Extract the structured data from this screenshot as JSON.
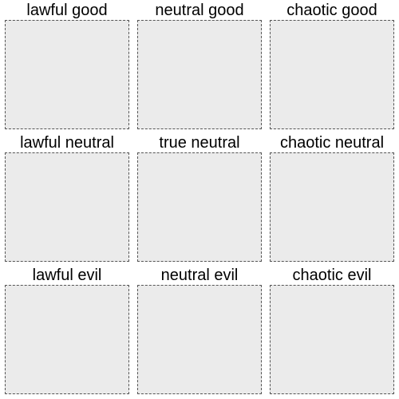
{
  "grid": {
    "cells": [
      {
        "id": "lawful-good",
        "label": "lawful good"
      },
      {
        "id": "neutral-good",
        "label": "neutral good"
      },
      {
        "id": "chaotic-good",
        "label": "chaotic good"
      },
      {
        "id": "lawful-neutral",
        "label": "lawful neutral"
      },
      {
        "id": "true-neutral",
        "label": "true neutral"
      },
      {
        "id": "chaotic-neutral",
        "label": "chaotic neutral"
      },
      {
        "id": "lawful-evil",
        "label": "lawful evil"
      },
      {
        "id": "neutral-evil",
        "label": "neutral evil"
      },
      {
        "id": "chaotic-evil",
        "label": "chaotic evil"
      }
    ]
  }
}
